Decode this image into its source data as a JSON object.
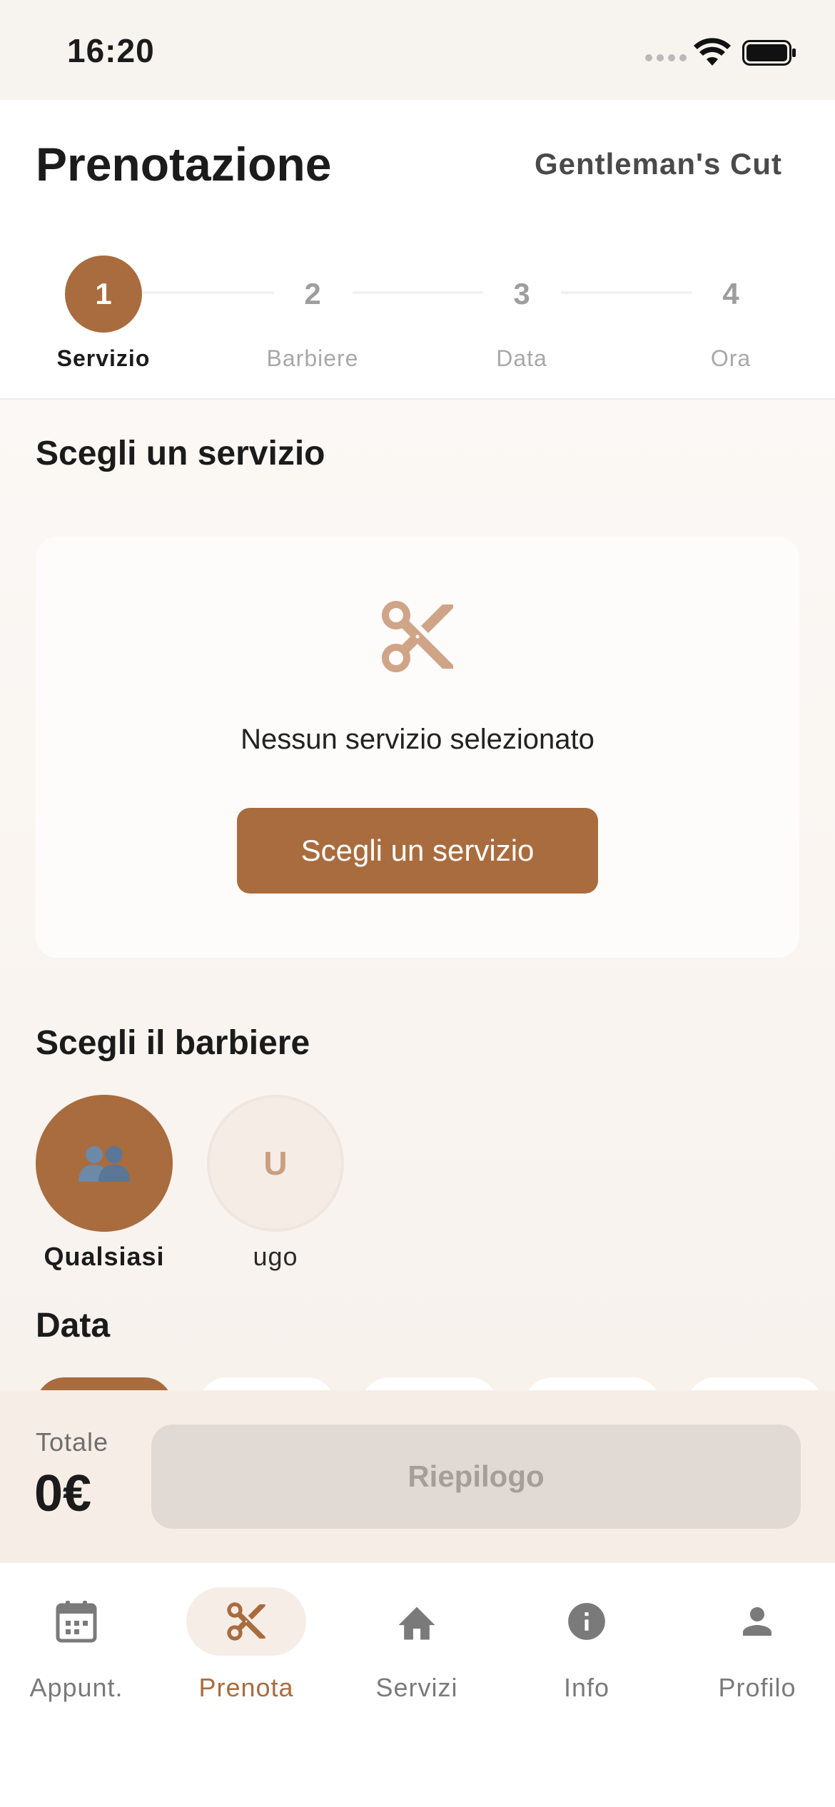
{
  "status_bar": {
    "time": "16:20"
  },
  "header": {
    "title": "Prenotazione",
    "shop_name": "Gentleman's Cut",
    "steps": [
      {
        "number": "1",
        "label": "Servizio",
        "active": true
      },
      {
        "number": "2",
        "label": "Barbiere",
        "active": false
      },
      {
        "number": "3",
        "label": "Data",
        "active": false
      },
      {
        "number": "4",
        "label": "Ora",
        "active": false
      }
    ]
  },
  "service_section": {
    "title": "Scegli un servizio",
    "icon": "scissors-icon",
    "empty_text": "Nessun servizio selezionato",
    "button_label": "Scegli un servizio"
  },
  "barber_section": {
    "title": "Scegli il barbiere",
    "barbers": [
      {
        "name": "Qualsiasi",
        "icon": "group-icon",
        "selected": true
      },
      {
        "name": "ugo",
        "initial": "U",
        "selected": false
      }
    ]
  },
  "date_section": {
    "title": "Data"
  },
  "summary": {
    "total_label": "Totale",
    "total_value": "0€",
    "button_label": "Riepilogo"
  },
  "nav": {
    "items": [
      {
        "label": "Appunt.",
        "icon": "calendar-icon",
        "active": false
      },
      {
        "label": "Prenota",
        "icon": "scissors-icon",
        "active": true
      },
      {
        "label": "Servizi",
        "icon": "home-icon",
        "active": false
      },
      {
        "label": "Info",
        "icon": "info-icon",
        "active": false
      },
      {
        "label": "Profilo",
        "icon": "person-icon",
        "active": false
      }
    ]
  },
  "colors": {
    "accent": "#a96c3e",
    "accent_light": "#c89f80",
    "background": "#fbf8f5",
    "disabled_button": "#e1d9d3"
  }
}
